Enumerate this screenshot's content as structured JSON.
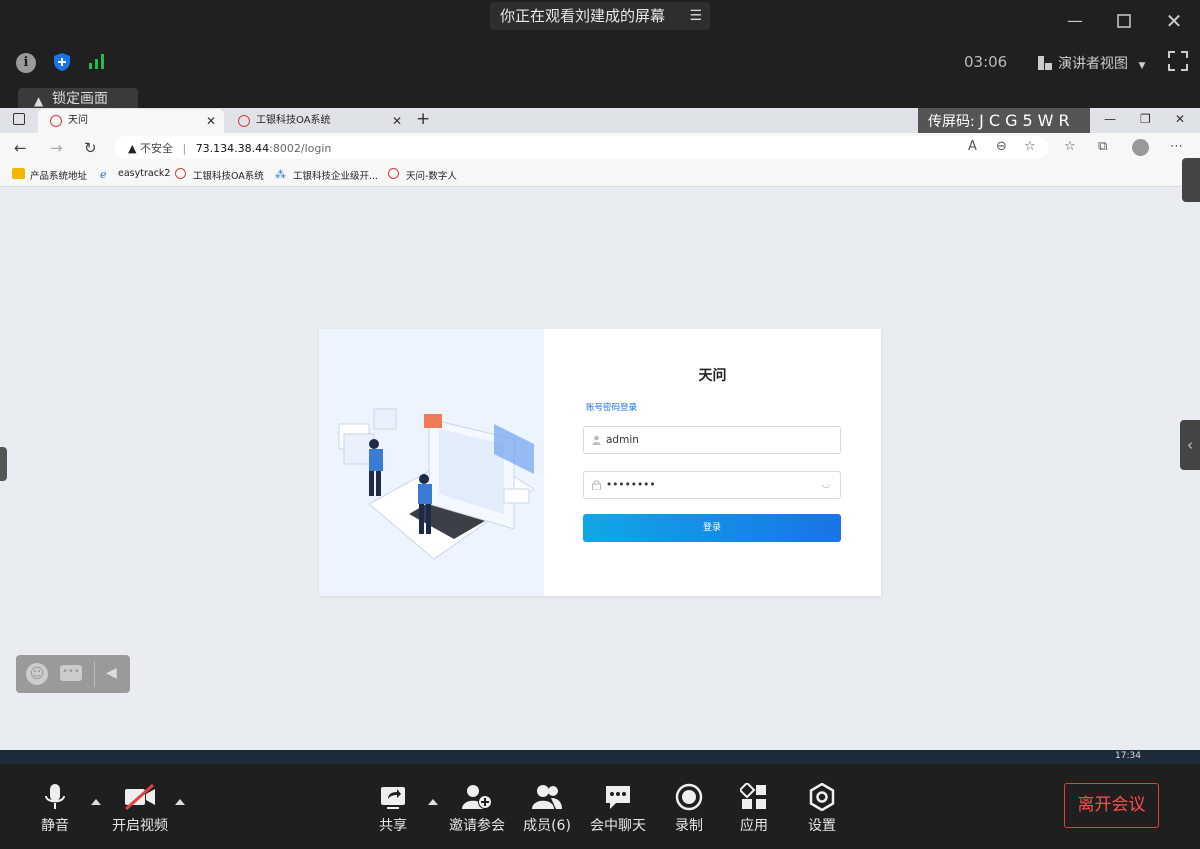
{
  "meeting": {
    "viewing_banner": "你正在观看刘建成的屏幕",
    "timer": "03:06",
    "view_mode": "演讲者视图",
    "lock_tab_label": "锁定画面",
    "capture_code_label": "传屏码:",
    "capture_code": "JCG5WR"
  },
  "browser": {
    "tabs": [
      {
        "label": "天问",
        "active": true
      },
      {
        "label": "工银科技OA系统",
        "active": false
      }
    ],
    "address": {
      "insecure_label": "不安全",
      "host": "73.134.38.44",
      "path": ":8002/login"
    },
    "bookmarks": [
      "产品系统地址",
      "easytrack2",
      "工银科技OA系统",
      "工银科技企业级开...",
      "天问-数字人"
    ]
  },
  "login": {
    "title": "天问",
    "mode_label": "账号密码登录",
    "username": "admin",
    "password_mask": "••••••••",
    "submit_label": "登录"
  },
  "taskbar": {
    "clock": "17:34"
  },
  "toolbar": {
    "mute": "静音",
    "video": "开启视频",
    "share": "共享",
    "invite": "邀请参会",
    "members": "成员(6)",
    "chat": "会中聊天",
    "record": "录制",
    "apps": "应用",
    "settings": "设置",
    "leave": "离开会议"
  },
  "colors": {
    "accent": "#1a73e8",
    "leave": "#ff4d4d",
    "panel": "#1f1f1f"
  }
}
